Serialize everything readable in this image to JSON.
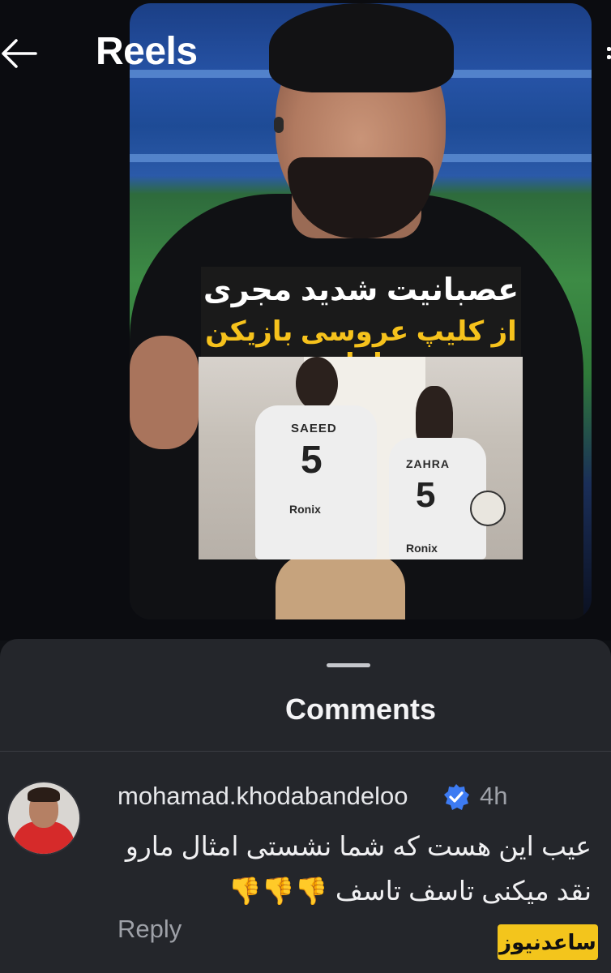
{
  "header": {
    "title": "Reels",
    "back_icon": "arrow-left-icon"
  },
  "reel": {
    "headline_line1": "عصبانیت شدید مجری",
    "headline_line2": "از کلیپ عروسی بازیکن ملوان",
    "jersey_him": {
      "name": "SAEED",
      "number": "5",
      "brand": "Ronix"
    },
    "jersey_her": {
      "name": "ZAHRA",
      "number": "5",
      "brand": "Ronix"
    }
  },
  "comments_sheet": {
    "title": "Comments",
    "comment": {
      "username": "mohamad.khodabandeloo",
      "verified_icon": "verified-badge-icon",
      "time": "4h",
      "text_line1": "عیب این هست که شما نشستی امثال مارو",
      "text_line2": "نقد میکنی تاسف تاسف 👎👎👎",
      "reply_label": "Reply"
    }
  },
  "watermark": "ساعدنیوز",
  "colors": {
    "sheet_bg": "#24262b",
    "verified_blue": "#3d7bf2",
    "headline_yellow": "#f6c21c",
    "watermark_yellow": "#f3c51c"
  }
}
